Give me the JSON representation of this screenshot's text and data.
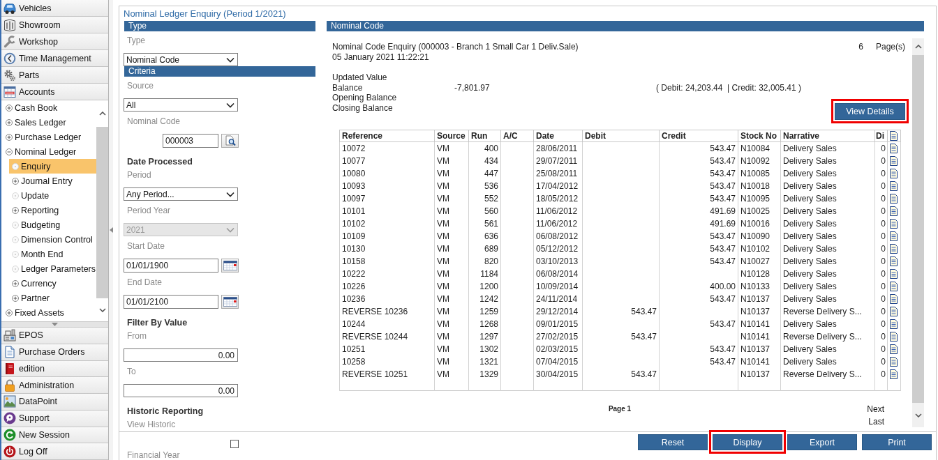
{
  "sidebar": {
    "top_modules": [
      {
        "label": "Vehicles"
      },
      {
        "label": "Showroom"
      },
      {
        "label": "Workshop"
      },
      {
        "label": "Time Management"
      },
      {
        "label": "Parts"
      },
      {
        "label": "Accounts"
      }
    ],
    "tree": [
      {
        "label": "Cash Book",
        "kind": "branch",
        "expanded": false,
        "selected": false
      },
      {
        "label": "Sales Ledger",
        "kind": "branch",
        "expanded": false,
        "selected": false
      },
      {
        "label": "Purchase Ledger",
        "kind": "branch",
        "expanded": false,
        "selected": false
      },
      {
        "label": "Nominal Ledger",
        "kind": "branch",
        "expanded": true,
        "selected": false,
        "children": [
          {
            "label": "Enquiry",
            "kind": "leaf",
            "selected": true
          },
          {
            "label": "Journal Entry",
            "kind": "branch",
            "expanded": false,
            "selected": false
          },
          {
            "label": "Update",
            "kind": "leaf",
            "selected": false
          },
          {
            "label": "Reporting",
            "kind": "branch",
            "expanded": false,
            "selected": false
          },
          {
            "label": "Budgeting",
            "kind": "leaf",
            "selected": false
          },
          {
            "label": "Dimension Control",
            "kind": "leaf",
            "selected": false
          },
          {
            "label": "Month End",
            "kind": "leaf",
            "selected": false
          },
          {
            "label": "Ledger Parameters",
            "kind": "leaf",
            "selected": false
          },
          {
            "label": "Currency",
            "kind": "branch",
            "expanded": false,
            "selected": false
          },
          {
            "label": "Partner",
            "kind": "branch",
            "expanded": false,
            "selected": false
          }
        ]
      },
      {
        "label": "Fixed Assets",
        "kind": "branch",
        "expanded": false,
        "selected": false
      }
    ],
    "bottom_modules": [
      {
        "label": "EPOS"
      },
      {
        "label": "Purchase Orders"
      },
      {
        "label": "edition"
      },
      {
        "label": "Administration"
      },
      {
        "label": "DataPoint"
      },
      {
        "label": "Support"
      },
      {
        "label": "New Session"
      },
      {
        "label": "Log Off"
      }
    ]
  },
  "page": {
    "title": "Nominal Ledger Enquiry (Period 1/2021)"
  },
  "criteria": {
    "fields": [
      {
        "kind": "section",
        "title": "Type"
      },
      {
        "kind": "label",
        "text": "Type"
      },
      {
        "kind": "select",
        "value": "Nominal Code",
        "disabled": false
      },
      {
        "kind": "section",
        "title": "Criteria"
      },
      {
        "kind": "label",
        "text": "Source"
      },
      {
        "kind": "select",
        "value": "All",
        "disabled": false
      },
      {
        "kind": "label",
        "text": "Nominal Code"
      },
      {
        "kind": "lookup_field",
        "value": "000003"
      },
      {
        "kind": "heading",
        "text": "Date Processed"
      },
      {
        "kind": "label",
        "text": "Period"
      },
      {
        "kind": "select",
        "value": "Any Period...",
        "disabled": false
      },
      {
        "kind": "label",
        "text": "Period Year"
      },
      {
        "kind": "select",
        "value": "2021",
        "disabled": true
      },
      {
        "kind": "label",
        "text": "Start Date"
      },
      {
        "kind": "date_field",
        "value": "01/01/1900"
      },
      {
        "kind": "label",
        "text": "End Date"
      },
      {
        "kind": "date_field",
        "value": "01/01/2100"
      },
      {
        "kind": "heading",
        "text": "Filter By Value"
      },
      {
        "kind": "label",
        "text": "From"
      },
      {
        "kind": "number_field",
        "value": "0.00"
      },
      {
        "kind": "label",
        "text": "To"
      },
      {
        "kind": "number_field",
        "value": "0.00"
      },
      {
        "kind": "heading",
        "text": "Historic Reporting"
      },
      {
        "kind": "label",
        "text": "View Historic"
      },
      {
        "kind": "checkbox",
        "checked": false
      },
      {
        "kind": "label",
        "text": "Financial Year"
      }
    ]
  },
  "results": {
    "title": "Nominal Code",
    "heading": "Nominal Code Enquiry (000003 - Branch 1 Small Car 1 Deliv.Sale)",
    "page_count": "6",
    "page_count_label": "Page(s)",
    "timestamp": "05 January 2021 11:22:21",
    "summary": [
      {
        "label": "Updated Value"
      },
      {
        "label": "Balance",
        "value": "-7,801.97",
        "totals": "( Debit: 24,203.44  | Credit: 32,005.41 )"
      },
      {
        "label": "Opening Balance"
      },
      {
        "label": "Closing Balance"
      }
    ],
    "view_details_button": {
      "label": "View Details",
      "highlighted": true
    },
    "table": {
      "columns": [
        "Reference",
        "Source",
        "Run",
        "A/C",
        "Date",
        "Debit",
        "Credit",
        "Stock No",
        "Narrative",
        "Di"
      ],
      "rows": [
        {
          "reference": "10072",
          "source": "VM",
          "run": "400",
          "date": "28/06/2011",
          "credit": "543.47",
          "stock_no": "N10084",
          "narrative": "Delivery Sales",
          "column_10": "0"
        },
        {
          "reference": "10077",
          "source": "VM",
          "run": "434",
          "date": "29/07/2011",
          "credit": "543.47",
          "stock_no": "N10092",
          "narrative": "Delivery Sales",
          "column_10": "0"
        },
        {
          "reference": "10080",
          "source": "VM",
          "run": "447",
          "date": "25/08/2011",
          "credit": "543.47",
          "stock_no": "N10085",
          "narrative": "Delivery Sales",
          "column_10": "0"
        },
        {
          "reference": "10093",
          "source": "VM",
          "run": "536",
          "date": "17/04/2012",
          "credit": "543.47",
          "stock_no": "N10018",
          "narrative": "Delivery Sales",
          "column_10": "0"
        },
        {
          "reference": "10097",
          "source": "VM",
          "run": "552",
          "date": "18/05/2012",
          "credit": "543.47",
          "stock_no": "N10095",
          "narrative": "Delivery Sales",
          "column_10": "0"
        },
        {
          "reference": "10101",
          "source": "VM",
          "run": "560",
          "date": "11/06/2012",
          "credit": "491.69",
          "stock_no": "N10025",
          "narrative": "Delivery Sales",
          "column_10": "0"
        },
        {
          "reference": "10102",
          "source": "VM",
          "run": "561",
          "date": "11/06/2012",
          "credit": "491.69",
          "stock_no": "N10016",
          "narrative": "Delivery Sales",
          "column_10": "0"
        },
        {
          "reference": "10109",
          "source": "VM",
          "run": "636",
          "date": "06/08/2012",
          "credit": "543.47",
          "stock_no": "N10090",
          "narrative": "Delivery Sales",
          "column_10": "0"
        },
        {
          "reference": "10130",
          "source": "VM",
          "run": "689",
          "date": "05/12/2012",
          "credit": "543.47",
          "stock_no": "N10102",
          "narrative": "Delivery Sales",
          "column_10": "0"
        },
        {
          "reference": "10158",
          "source": "VM",
          "run": "820",
          "date": "03/10/2013",
          "credit": "543.47",
          "stock_no": "N10027",
          "narrative": "Delivery Sales",
          "column_10": "0"
        },
        {
          "reference": "10222",
          "source": "VM",
          "run": "1184",
          "date": "06/08/2014",
          "stock_no": "N10128",
          "narrative": "Delivery Sales",
          "column_10": "0"
        },
        {
          "reference": "10226",
          "source": "VM",
          "run": "1200",
          "date": "10/09/2014",
          "credit": "400.00",
          "stock_no": "N10133",
          "narrative": "Delivery Sales",
          "column_10": "0"
        },
        {
          "reference": "10236",
          "source": "VM",
          "run": "1242",
          "date": "24/11/2014",
          "credit": "543.47",
          "stock_no": "N10137",
          "narrative": "Delivery Sales",
          "column_10": "0"
        },
        {
          "reference": "REVERSE 10236",
          "source": "VM",
          "run": "1259",
          "date": "29/12/2014",
          "debit": "543.47",
          "stock_no": "N10137",
          "narrative": "Reverse Delivery S...",
          "column_10": "0"
        },
        {
          "reference": "10244",
          "source": "VM",
          "run": "1268",
          "date": "09/01/2015",
          "credit": "543.47",
          "stock_no": "N10141",
          "narrative": "Delivery Sales",
          "column_10": "0"
        },
        {
          "reference": "REVERSE 10244",
          "source": "VM",
          "run": "1297",
          "date": "27/02/2015",
          "debit": "543.47",
          "stock_no": "N10141",
          "narrative": "Reverse Delivery S...",
          "column_10": "0"
        },
        {
          "reference": "10251",
          "source": "VM",
          "run": "1302",
          "date": "02/03/2015",
          "credit": "543.47",
          "stock_no": "N10137",
          "narrative": "Delivery Sales",
          "column_10": "0"
        },
        {
          "reference": "10258",
          "source": "VM",
          "run": "1321",
          "date": "07/04/2015",
          "credit": "543.47",
          "stock_no": "N10141",
          "narrative": "Delivery Sales",
          "column_10": "0"
        },
        {
          "reference": "REVERSE 10251",
          "source": "VM",
          "run": "1329",
          "date": "30/04/2015",
          "debit": "543.47",
          "stock_no": "N10137",
          "narrative": "Reverse Delivery S...",
          "column_10": "0"
        }
      ]
    },
    "pager": {
      "current": "Page 1",
      "links": [
        "Next",
        "Last"
      ]
    }
  },
  "buttons": [
    {
      "label": "Reset",
      "highlighted": false
    },
    {
      "label": "Display",
      "highlighted": true
    },
    {
      "label": "Export",
      "highlighted": false
    },
    {
      "label": "Print",
      "highlighted": false
    }
  ]
}
